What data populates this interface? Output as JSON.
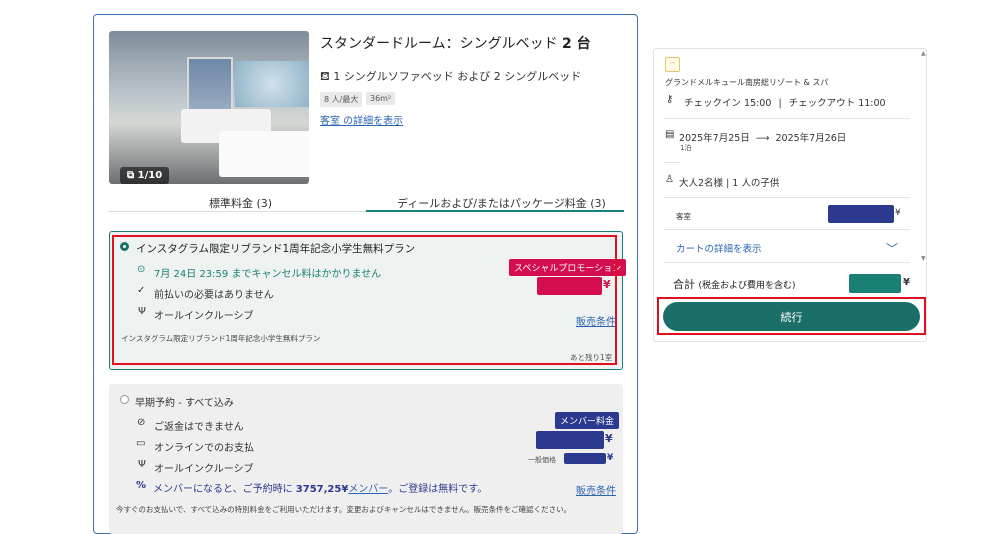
{
  "room": {
    "title_prefix": "スタンダードルーム：シングルベッド",
    "title_bold": "2 台",
    "bed_text": "1 シングルソファベッド および 2 シングルベッド",
    "tags": [
      "8 人/最大",
      "36m²"
    ],
    "details_link": "客室 の詳細を表示",
    "photo_counter": "1/10"
  },
  "tabs": [
    {
      "label": "標準料金 (3)"
    },
    {
      "label": "ディールおよび/またはパッケージ料金 (3)"
    }
  ],
  "plan1": {
    "name": "インスタグラム限定リブランド1周年記念小学生無料プラン",
    "cancel_text": "7月 24日 23:59 までキャンセル料はかかりません",
    "prepay_text": "前払いの必要はありません",
    "inclusive_text": "オールインクルーシブ",
    "promo_badge": "スペシャルプロモーション",
    "currency": "¥",
    "sales_terms": "販売条件",
    "description": "インスタグラム限定リブランド1周年記念小学生無料プラン",
    "remaining": "あと残り1室"
  },
  "plan2": {
    "name": "早期予約 - すべて込み",
    "refund_text": "ご返金はできません",
    "online_pay_text": "オンラインでのお支払",
    "inclusive_text": "オールインクルーシブ",
    "member_badge": "メンバー料金",
    "currency": "¥",
    "general_price_label": "一般価格",
    "member_msg_1": "メンバーになると、ご予約時に",
    "member_msg_amount": "3757,25¥",
    "member_msg_link": "メンバー",
    "member_msg_2": "。ご登録は無料です。",
    "sales_terms": "販売条件",
    "footer_text": "今すぐのお支払いで、すべて込みの特別料金をご利用いただけます。変更およびキャンセルはできません。販売条件をご確認ください。"
  },
  "summary": {
    "hotel_name": "グランドメルキュール南房総リゾート & スパ",
    "checkin_text": "チェックイン 15:00",
    "separator": "|",
    "checkout_text": "チェックアウト 11:00",
    "dates_from": "2025年7月25日",
    "dates_arrow": "⟶",
    "dates_to": "2025年7月26日",
    "nights": "1泊",
    "guests": "大人2名様 | 1 人の子供",
    "room_label": "客室",
    "currency": "¥",
    "cart_details_link": "カートの詳細を表示",
    "total_label": "合計",
    "total_sub": "(税金および費用を含む)",
    "continue_button": "続行"
  },
  "colors": {
    "accent": "#1a7068",
    "promo": "#d40d4e",
    "member": "#2b3a8f",
    "highlight": "#e0101e",
    "link": "#2a65b0"
  }
}
